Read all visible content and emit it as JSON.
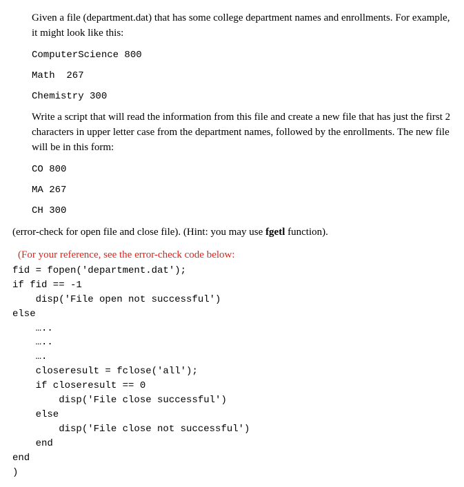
{
  "intro": "Given a file (department.dat) that has some college department names and enrollments.  For example, it might  look like this:",
  "sample_input": [
    "ComputerScience 800",
    "Math  267",
    "Chemistry 300"
  ],
  "task": "Write a script that will read the information from this file and create a new file that has just the first 2 characters in upper letter case from the department names, followed by the enrollments.  The new file will be in this form:",
  "sample_output": [
    "CO 800",
    "MA 267",
    "CH 300"
  ],
  "hint_pre": "(error-check for open file and close file).  (Hint: you may use ",
  "hint_bold": "fgetl",
  "hint_post": " function).",
  "ref_note": "  (For your reference,  see the error-check code below:",
  "code_lines": [
    "fid = fopen('department.dat');",
    "if fid == -1",
    "    disp('File open not successful')",
    "else",
    "    …..",
    "    …..",
    "    ….",
    "    closeresult = fclose('all');",
    "    if closeresult == 0",
    "        disp('File close successful')",
    "    else",
    "        disp('File close not successful')",
    "    end",
    "end",
    "",
    ")"
  ]
}
